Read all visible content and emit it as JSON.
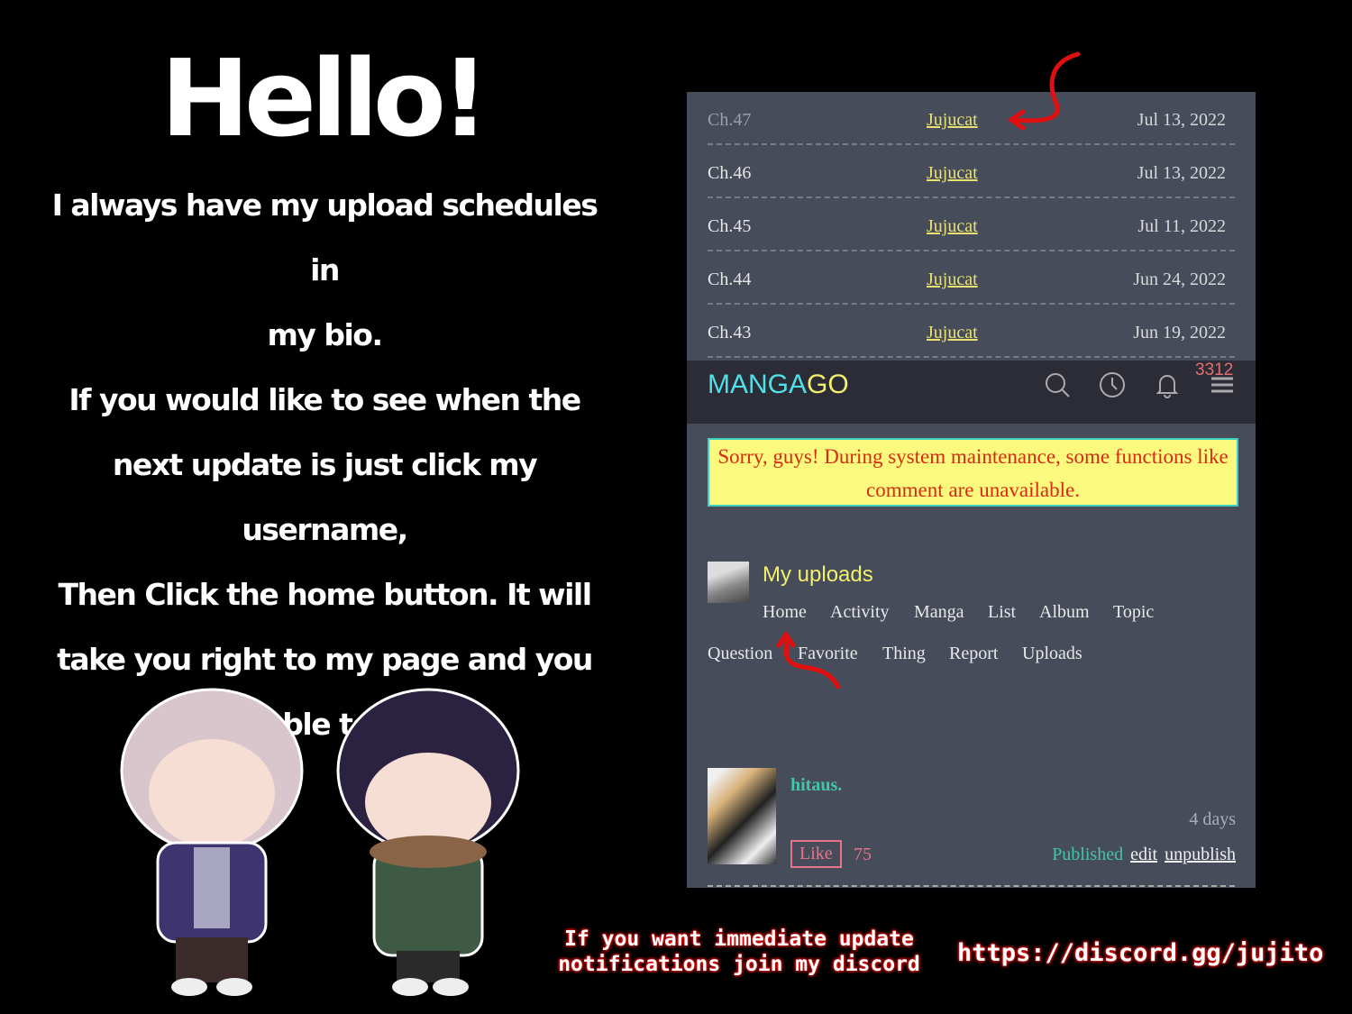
{
  "left": {
    "hello": "Hello!",
    "message": [
      "I always have my upload schedules in",
      "my bio.",
      "If you would like to see when the",
      "next update is just click my",
      "username,",
      "Then Click the home button. It will",
      "take you right to my page and you",
      "will be able to view it!"
    ]
  },
  "chapters": [
    {
      "chapter": "Ch.47",
      "uploader": "Jujucat",
      "date": "Jul 13, 2022"
    },
    {
      "chapter": "Ch.46",
      "uploader": "Jujucat",
      "date": "Jul 13, 2022"
    },
    {
      "chapter": "Ch.45",
      "uploader": "Jujucat",
      "date": "Jul 11, 2022"
    },
    {
      "chapter": "Ch.44",
      "uploader": "Jujucat",
      "date": "Jun 24, 2022"
    },
    {
      "chapter": "Ch.43",
      "uploader": "Jujucat",
      "date": "Jun 19, 2022"
    }
  ],
  "header": {
    "logo_a": "MANGA",
    "logo_b": "GO",
    "notification_count": "3312",
    "icons": [
      "search-icon",
      "history-icon",
      "bell-icon",
      "menu-icon"
    ]
  },
  "notice": "Sorry, guys! During system maintenance, some functions like comment are unavailable.",
  "profile": {
    "title": "My uploads",
    "nav": [
      "Home",
      "Activity",
      "Manga",
      "List",
      "Album",
      "Topic",
      "Question",
      "Favorite",
      "Thing",
      "Report",
      "Uploads"
    ]
  },
  "upload": {
    "name": "hitaus.",
    "time": "4 days",
    "like_label": "Like",
    "likes": "75",
    "status": "Published",
    "edit": "edit",
    "unpublish": "unpublish"
  },
  "discord": {
    "line1": "If you want immediate update",
    "line2": "notifications join my discord",
    "url": "https://discord.gg/jujito"
  },
  "colors": {
    "logo_cyan": "#4fe0ea",
    "logo_yellow": "#f2ee6e",
    "notice_bg": "#fbfa7e",
    "notice_text": "#d72a14",
    "arrow": "#e01010"
  }
}
